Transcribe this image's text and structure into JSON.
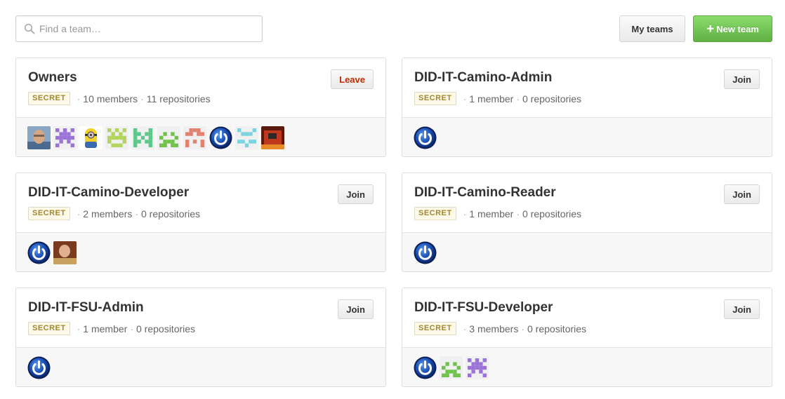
{
  "search": {
    "placeholder": "Find a team…",
    "value": ""
  },
  "header": {
    "my_teams_label": "My teams",
    "new_team_label": "New team",
    "new_team_plus": "+"
  },
  "colors": {
    "accent_green": "#60b044",
    "leave_red": "#bd2c00",
    "badge_bg": "#fff9ea",
    "badge_text": "#a1882b"
  },
  "teams": [
    {
      "name": "Owners",
      "badge": "SECRET",
      "members": "10 members",
      "sep": "·",
      "repos": "11 repositories",
      "action": "Leave",
      "avatars": [
        "photo-avatar-man",
        "identicon-purple",
        "minion-avatar",
        "identicon-lime",
        "identicon-green-teal",
        "identicon-green",
        "identicon-salmon",
        "power-icon-avatar",
        "identicon-cyan",
        "photo-avatar-red"
      ]
    },
    {
      "name": "DID-IT-Camino-Admin",
      "badge": "SECRET",
      "members": "1 member",
      "sep": "·",
      "repos": "0 repositories",
      "action": "Join",
      "avatars": [
        "power-icon-avatar"
      ]
    },
    {
      "name": "DID-IT-Camino-Developer",
      "badge": "SECRET",
      "members": "2 members",
      "sep": "·",
      "repos": "0 repositories",
      "action": "Join",
      "avatars": [
        "power-icon-avatar",
        "photo-avatar-man-2"
      ]
    },
    {
      "name": "DID-IT-Camino-Reader",
      "badge": "SECRET",
      "members": "1 member",
      "sep": "·",
      "repos": "0 repositories",
      "action": "Join",
      "avatars": [
        "power-icon-avatar"
      ]
    },
    {
      "name": "DID-IT-FSU-Admin",
      "badge": "SECRET",
      "members": "1 member",
      "sep": "·",
      "repos": "0 repositories",
      "action": "Join",
      "avatars": [
        "power-icon-avatar"
      ]
    },
    {
      "name": "DID-IT-FSU-Developer",
      "badge": "SECRET",
      "members": "3 members",
      "sep": "·",
      "repos": "0 repositories",
      "action": "Join",
      "avatars": [
        "power-icon-avatar",
        "identicon-green",
        "identicon-purple"
      ]
    }
  ]
}
